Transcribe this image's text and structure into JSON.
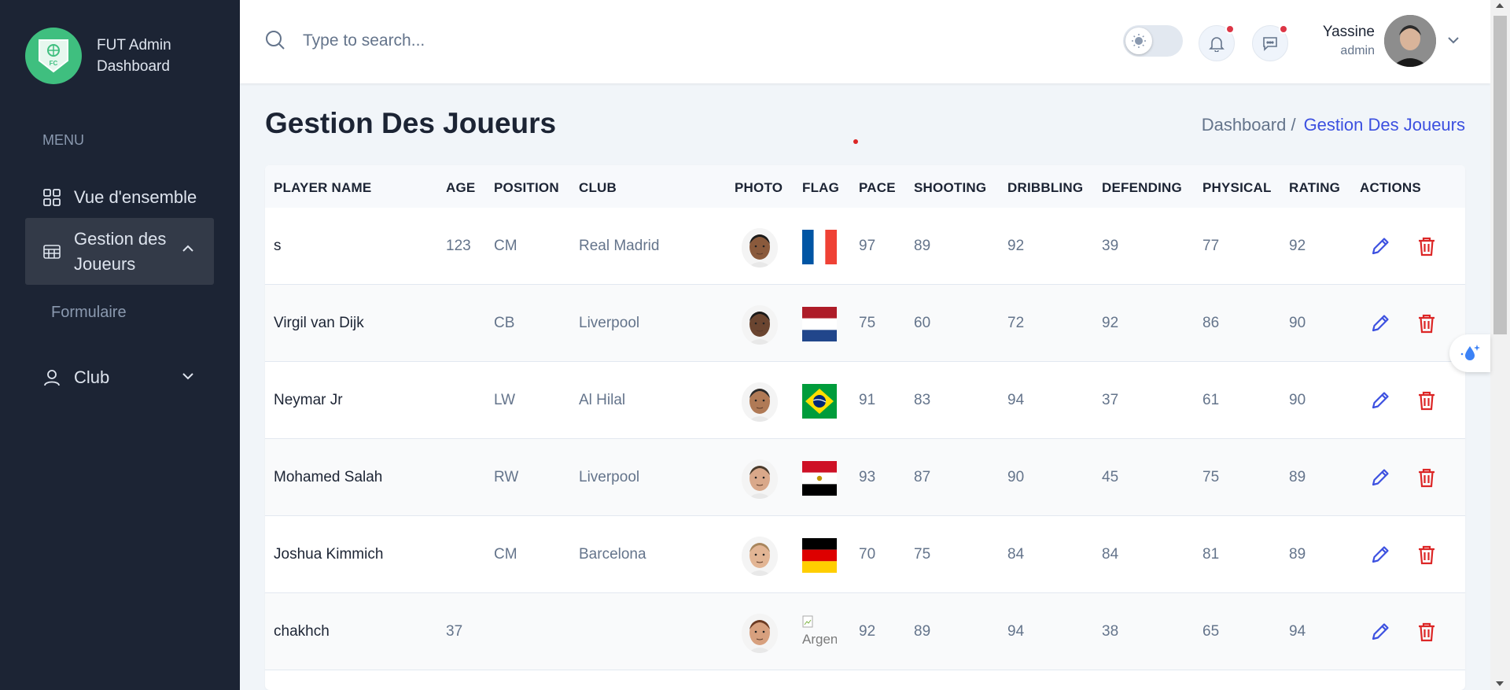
{
  "brand": {
    "line1": "FUT Admin",
    "line2": "Dashboard",
    "logo_text": "FC"
  },
  "sidebar": {
    "menu_heading": "MENU",
    "items": [
      {
        "label": "Vue d'ensemble",
        "icon": "grid-icon"
      },
      {
        "label_line1": "Gestion des",
        "label_line2": "Joueurs",
        "icon": "table-icon",
        "expanded": true
      },
      {
        "label": "Formulaire"
      },
      {
        "label": "Club",
        "icon": "user-icon",
        "expanded": false
      }
    ]
  },
  "header": {
    "search_placeholder": "Type to search...",
    "user_name": "Yassine",
    "user_role": "admin",
    "notification_color": "#dc3545"
  },
  "page": {
    "title": "Gestion Des Joueurs",
    "breadcrumb": [
      "Dashboard /",
      "Gestion Des Joueurs"
    ]
  },
  "table": {
    "columns": [
      "PLAYER NAME",
      "AGE",
      "POSITION",
      "CLUB",
      "PHOTO",
      "FLAG",
      "PACE",
      "SHOOTING",
      "DRIBBLING",
      "DEFENDING",
      "PHYSICAL",
      "RATING",
      "ACTIONS"
    ],
    "rows": [
      {
        "name": "s",
        "age": "123",
        "position": "CM",
        "club": "Real Madrid",
        "flag": "france",
        "pace": "97",
        "shooting": "89",
        "dribbling": "92",
        "defending": "39",
        "physical": "77",
        "rating": "92",
        "skin": "#8a5a3c",
        "hair": "#1a1a1a"
      },
      {
        "name": "Virgil van Dijk",
        "age": "",
        "position": "CB",
        "club": "Liverpool",
        "flag": "netherlands",
        "pace": "75",
        "shooting": "60",
        "dribbling": "72",
        "defending": "92",
        "physical": "86",
        "rating": "90",
        "skin": "#6b4530",
        "hair": "#1a1a1a"
      },
      {
        "name": "Neymar Jr",
        "age": "",
        "position": "LW",
        "club": "Al Hilal",
        "flag": "brazil",
        "pace": "91",
        "shooting": "83",
        "dribbling": "94",
        "defending": "37",
        "physical": "61",
        "rating": "90",
        "skin": "#b07a56",
        "hair": "#2a2a2a"
      },
      {
        "name": "Mohamed Salah",
        "age": "",
        "position": "RW",
        "club": "Liverpool",
        "flag": "egypt",
        "pace": "93",
        "shooting": "87",
        "dribbling": "90",
        "defending": "45",
        "physical": "75",
        "rating": "89",
        "skin": "#d9a88a",
        "hair": "#4a3b2c"
      },
      {
        "name": "Joshua Kimmich",
        "age": "",
        "position": "CM",
        "club": "Barcelona",
        "flag": "germany",
        "pace": "70",
        "shooting": "75",
        "dribbling": "84",
        "defending": "84",
        "physical": "81",
        "rating": "89",
        "skin": "#e2b594",
        "hair": "#a8865d"
      },
      {
        "name": "chakhch",
        "age": "37",
        "position": "",
        "club": "",
        "flag": "broken",
        "flag_alt": "Argen",
        "pace": "92",
        "shooting": "89",
        "dribbling": "94",
        "defending": "38",
        "physical": "65",
        "rating": "94",
        "skin": "#d7a07e",
        "hair": "#6b3a22"
      }
    ]
  },
  "colors": {
    "sidebar_bg": "#1c2434",
    "accent": "#3c50e0",
    "edit": "#3c50e0",
    "delete": "#dc2626"
  }
}
